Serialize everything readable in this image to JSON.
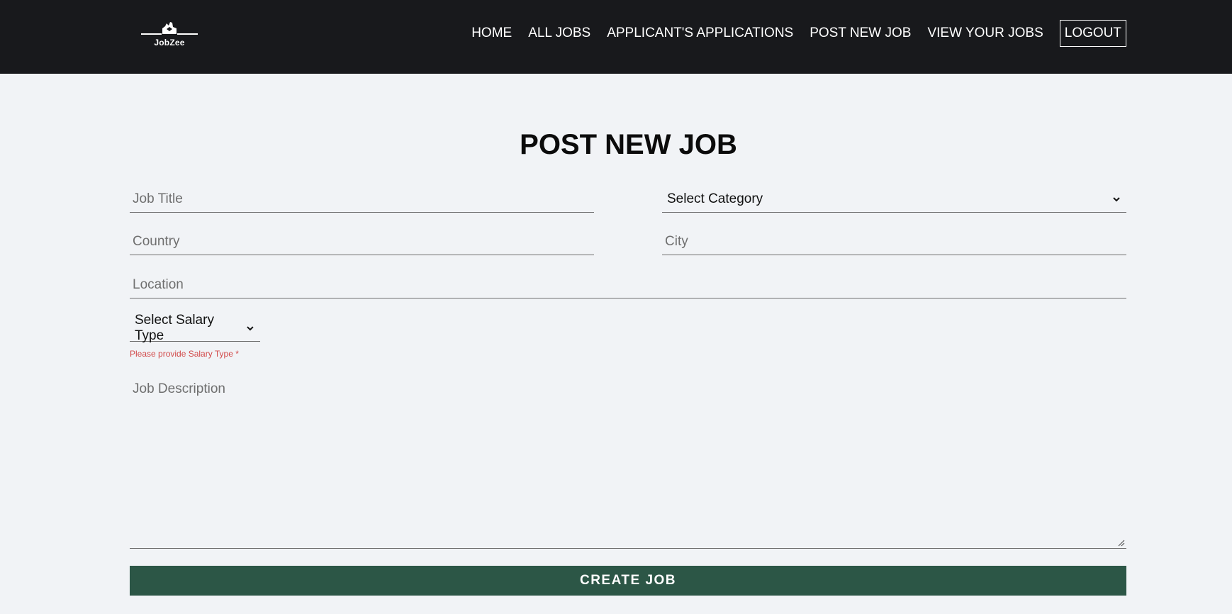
{
  "brand": {
    "name": "JobZee"
  },
  "nav": {
    "links": [
      "HOME",
      "ALL JOBS",
      "APPLICANT'S APPLICATIONS",
      "POST NEW JOB",
      "VIEW YOUR JOBS"
    ],
    "logout": "LOGOUT"
  },
  "page": {
    "title": "POST NEW JOB"
  },
  "form": {
    "job_title": {
      "placeholder": "Job Title",
      "value": ""
    },
    "category": {
      "selected": "Select Category"
    },
    "country": {
      "placeholder": "Country",
      "value": ""
    },
    "city": {
      "placeholder": "City",
      "value": ""
    },
    "location": {
      "placeholder": "Location",
      "value": ""
    },
    "salary_type": {
      "selected": "Select Salary Type"
    },
    "salary_error": "Please provide Salary Type *",
    "description": {
      "placeholder": "Job Description",
      "value": ""
    },
    "submit_label": "CREATE JOB"
  },
  "colors": {
    "navbar_bg": "#18191c",
    "page_bg": "#f1f3f6",
    "button_bg": "#2c5646",
    "error_text": "#d24a4a"
  },
  "icons": {
    "logo": "jobzee-logo-icon",
    "select_arrow": "chevron-down-icon",
    "textarea_resize": "resize-grip-icon"
  }
}
